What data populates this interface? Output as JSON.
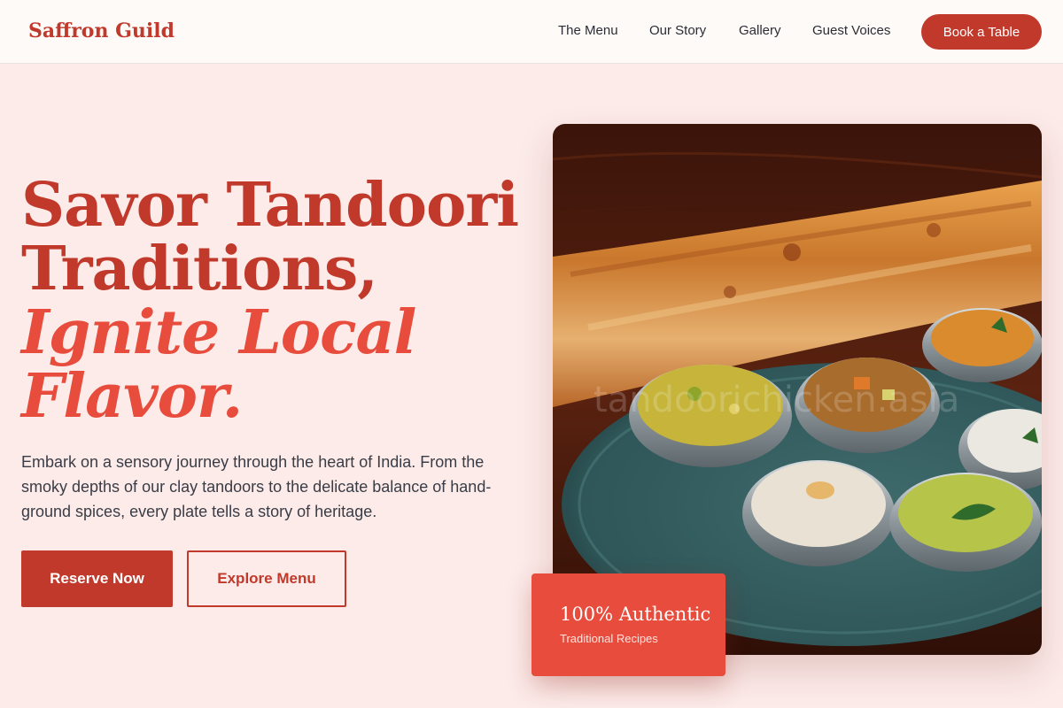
{
  "brand": {
    "name": "Saffron Guild"
  },
  "nav": {
    "items": [
      {
        "label": "The Menu"
      },
      {
        "label": "Our Story"
      },
      {
        "label": "Gallery"
      },
      {
        "label": "Guest Voices"
      }
    ],
    "cta_label": "Book a Table"
  },
  "hero": {
    "headline_line1": "Savor Tandoori",
    "headline_line2": "Traditions,",
    "headline_line3": "Ignite Local",
    "headline_line4": "Flavor.",
    "lede": "Embark on a sensory journey through the heart of India. From the smoky depths of our clay tandoors to the delicate balance of hand-ground spices, every plate tells a story of heritage.",
    "primary_cta": "Reserve Now",
    "secondary_cta": "Explore Menu",
    "image_watermark": "tandoorichicken.asia"
  },
  "badge": {
    "title": "100% Authentic",
    "subtitle": "Traditional Recipes"
  },
  "colors": {
    "brand_red": "#c0392b",
    "accent_red": "#e74c3c",
    "page_background": "#fcebe9",
    "header_background": "#fdfaf8"
  }
}
